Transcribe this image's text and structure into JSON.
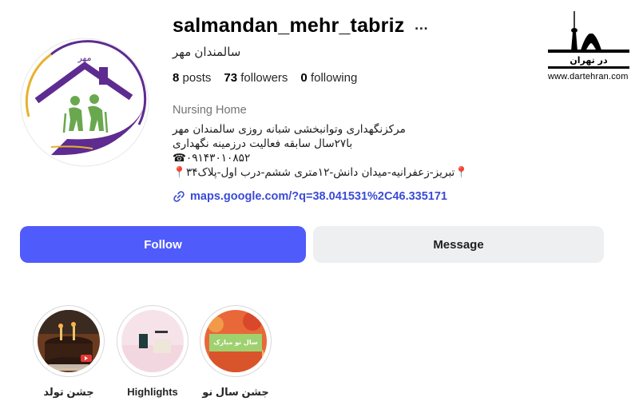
{
  "profile": {
    "username": "salmandan_mehr_tabriz",
    "more_icon": "…",
    "full_name": "سالمندان مهر",
    "avatar_text_top": "مهر"
  },
  "stats": {
    "posts_count": "8",
    "posts_label": "posts",
    "followers_count": "73",
    "followers_label": "followers",
    "following_count": "0",
    "following_label": "following"
  },
  "bio": {
    "category": "Nursing Home",
    "line1": "مرکزنگهداری وتوانبخشی شبانه روزی سالمندان مهر",
    "line2": "با۲۷سال سابقه فعالیت درزمینه نگهداری",
    "line3": "☎۰۹۱۴۳۰۱۰۸۵۲",
    "line4": "📍تبریز-زعفرانیه-میدان دانش-۱۲متری ششم-درب اول-پلاک۳۴📍",
    "link": "maps.google.com/?q=38.041531%2C46.335171"
  },
  "buttons": {
    "follow": "Follow",
    "message": "Message"
  },
  "highlights": [
    {
      "label": "جشن تولد"
    },
    {
      "label": "Highlights"
    },
    {
      "label": "جشن سال نو",
      "badge": "سال نو مبارک"
    }
  ],
  "watermark": {
    "url": "www.dartehran.com",
    "brand": "در تهران"
  },
  "colors": {
    "follow_bg": "#4f5bfb",
    "message_bg": "#eeeff1",
    "link": "#3a4bd6",
    "avatar_purple": "#5e2b91",
    "avatar_green": "#6aa84f",
    "avatar_gold": "#e8b22e"
  }
}
